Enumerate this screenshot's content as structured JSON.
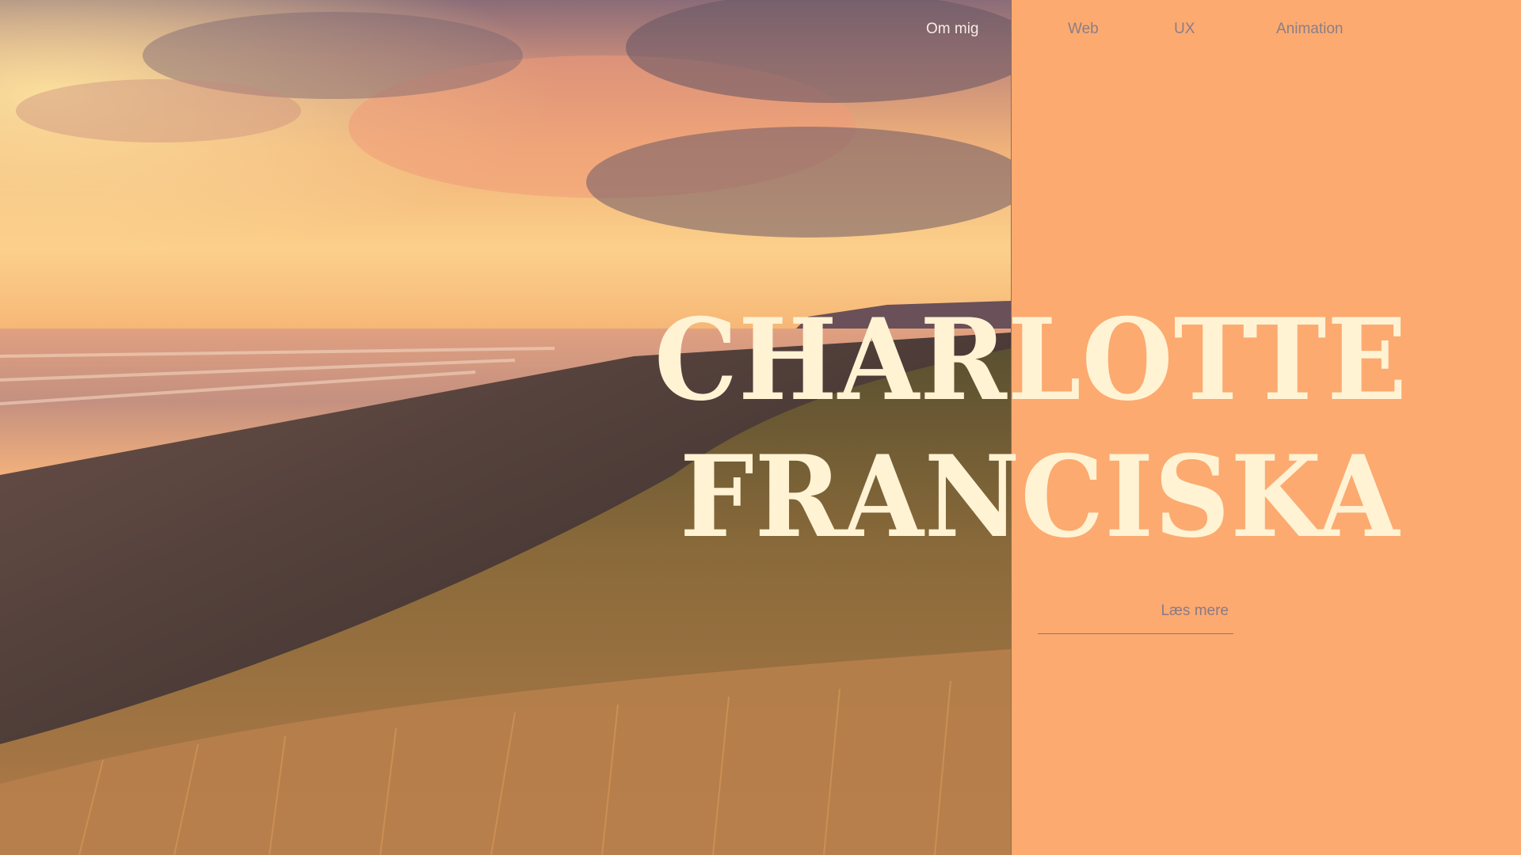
{
  "nav": {
    "items": [
      {
        "label": "Om mig"
      },
      {
        "label": "Web"
      },
      {
        "label": "UX"
      },
      {
        "label": "Animation"
      }
    ]
  },
  "hero": {
    "title_line1": "CHARLOTTE",
    "title_line2": "FRANCISKA",
    "cta_label": "Læs mere"
  },
  "colors": {
    "panel": "#fcaa70",
    "title": "#fff3d4",
    "nav_active": "#f7ece4",
    "nav_muted": "#8a7e88"
  }
}
